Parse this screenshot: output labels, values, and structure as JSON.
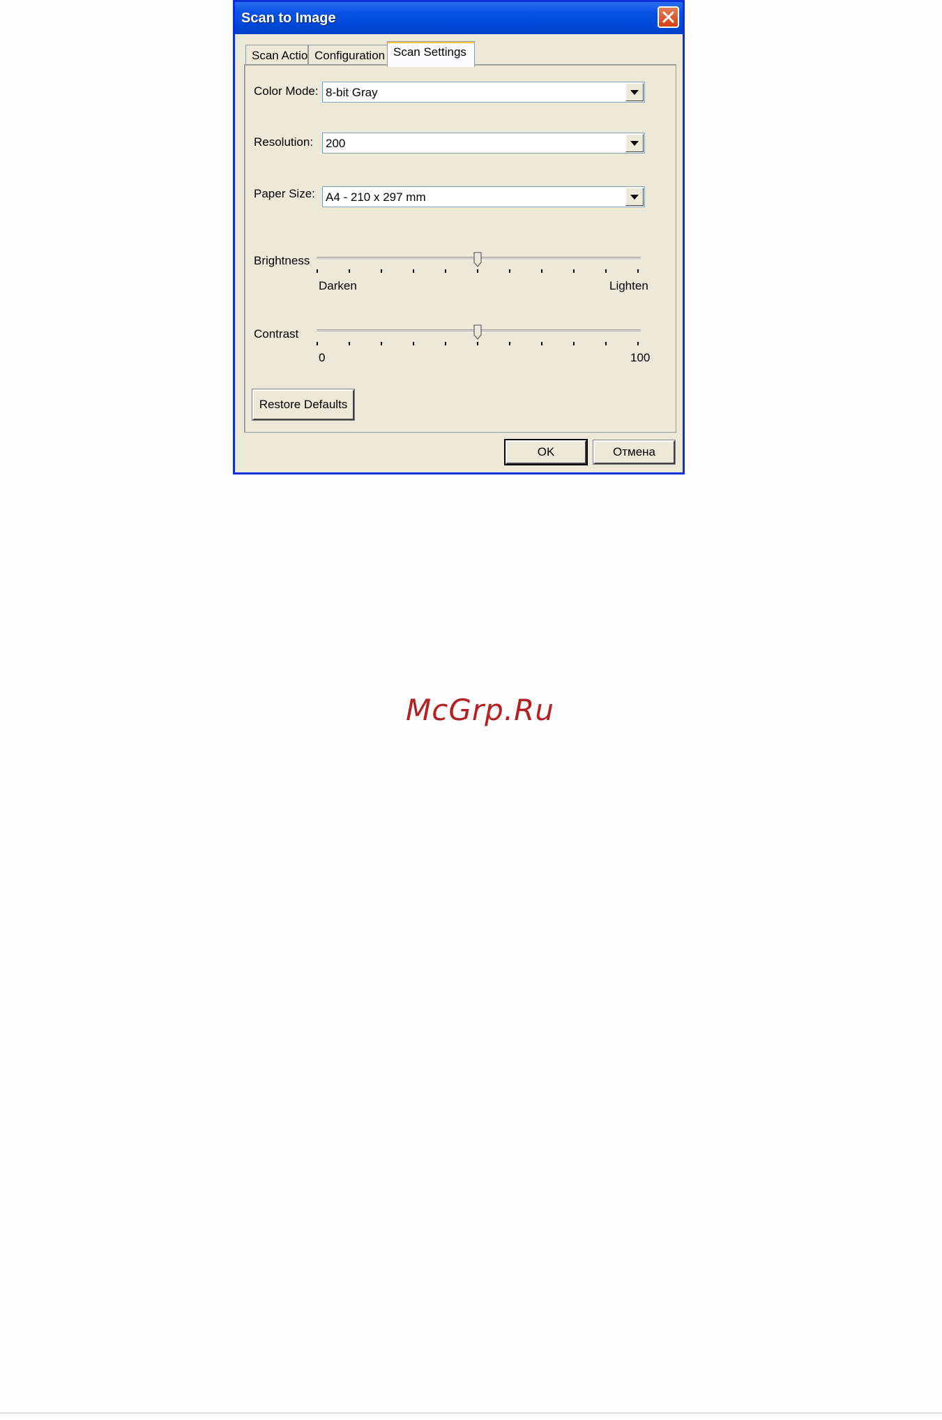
{
  "window": {
    "title": "Scan to Image"
  },
  "tabs": [
    {
      "label": "Scan Action"
    },
    {
      "label": "Configuration"
    },
    {
      "label": "Scan Settings"
    }
  ],
  "active_tab": "Scan Settings",
  "fields": {
    "color_mode": {
      "label": "Color Mode:",
      "value": "8-bit Gray"
    },
    "resolution": {
      "label": "Resolution:",
      "value": "200"
    },
    "paper_size": {
      "label": "Paper Size:",
      "value": "A4 - 210 x 297 mm"
    }
  },
  "brightness": {
    "label": "Brightness",
    "min_label": "Darken",
    "max_label": "Lighten",
    "level": 0.5
  },
  "contrast": {
    "label": "Contrast",
    "min_label": "0",
    "max_label": "100",
    "level": 0.5
  },
  "buttons": {
    "restore_defaults": "Restore Defaults",
    "ok": "OK",
    "cancel": "Отмена"
  },
  "watermark": "McGrp.Ru",
  "colors": {
    "titlebar": "#0054e3",
    "dialog_bg": "#ece9d8",
    "close": "#d8400f",
    "watermark": "#b22222"
  }
}
